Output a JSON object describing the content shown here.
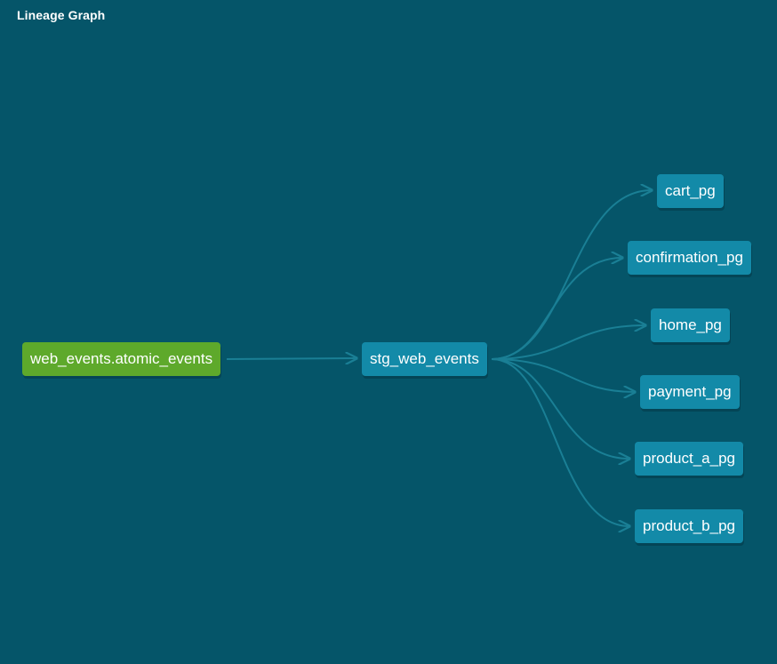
{
  "title": "Lineage Graph",
  "colors": {
    "background": "#055569",
    "source_node": "#5ea92b",
    "model_node": "#138aa8",
    "edge": "#1a7f95"
  },
  "nodes": {
    "source": "web_events.atomic_events",
    "staging": "stg_web_events",
    "children": [
      "cart_pg",
      "confirmation_pg",
      "home_pg",
      "payment_pg",
      "product_a_pg",
      "product_b_pg"
    ]
  }
}
